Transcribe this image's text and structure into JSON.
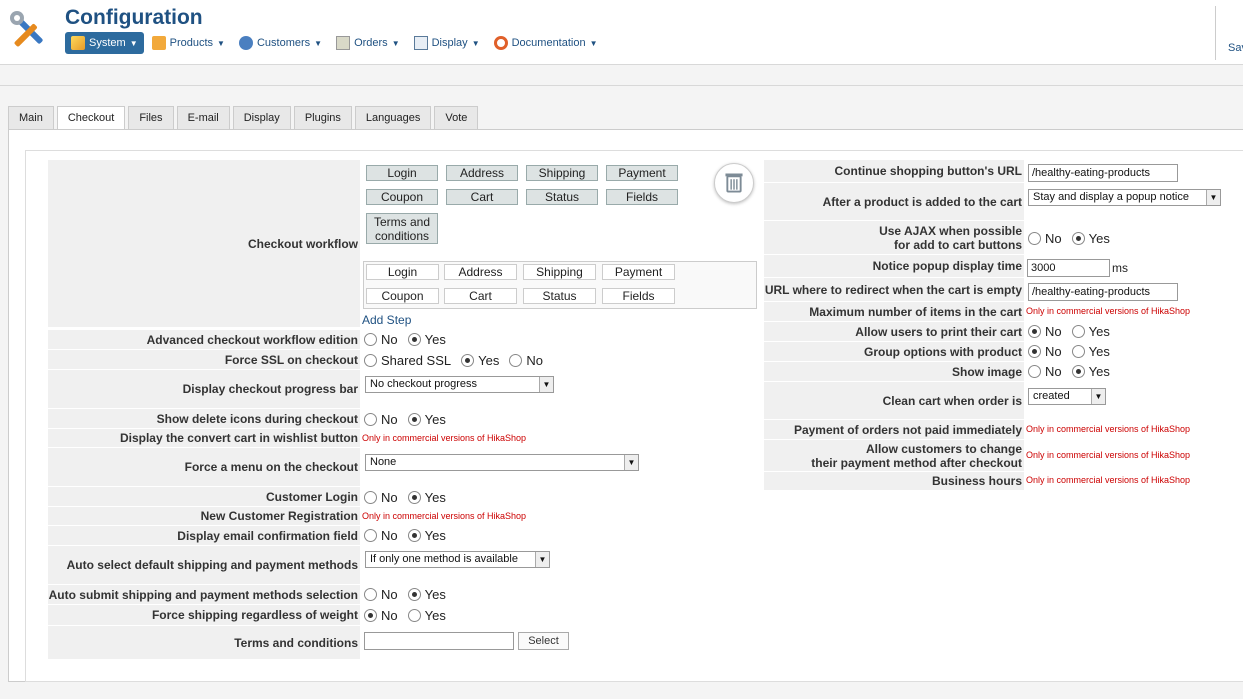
{
  "header": {
    "title": "Configuration",
    "save_label": "Sav",
    "menu": [
      {
        "label": "System"
      },
      {
        "label": "Products"
      },
      {
        "label": "Customers"
      },
      {
        "label": "Orders"
      },
      {
        "label": "Display"
      },
      {
        "label": "Documentation"
      }
    ]
  },
  "tabs": [
    "Main",
    "Checkout",
    "Files",
    "E-mail",
    "Display",
    "Plugins",
    "Languages",
    "Vote"
  ],
  "active_tab": "Checkout",
  "workflow": {
    "label": "Checkout workflow",
    "row1": [
      "Login",
      "Address",
      "Shipping",
      "Payment"
    ],
    "row2": [
      "Coupon",
      "Cart",
      "Status",
      "Fields"
    ],
    "extra": "Terms and conditions",
    "box_row1": [
      "Login",
      "Address",
      "Shipping",
      "Payment"
    ],
    "box_row2": [
      "Coupon",
      "Cart",
      "Status",
      "Fields"
    ],
    "add_step": "Add Step"
  },
  "left": {
    "advanced_workflow": {
      "label": "Advanced checkout workflow edition",
      "no": "No",
      "yes": "Yes"
    },
    "force_ssl": {
      "label": "Force SSL on checkout",
      "shared": "Shared SSL",
      "yes": "Yes",
      "no": "No"
    },
    "progress_bar": {
      "label": "Display checkout progress bar",
      "value": "No checkout progress"
    },
    "delete_icons": {
      "label": "Show delete icons during checkout",
      "no": "No",
      "yes": "Yes"
    },
    "convert_cart": {
      "label": "Display the convert cart in wishlist button",
      "note": "Only in commercial versions of HikaShop"
    },
    "force_menu": {
      "label": "Force a menu on the checkout",
      "value": "None"
    },
    "customer_login": {
      "label": "Customer Login",
      "no": "No",
      "yes": "Yes"
    },
    "new_registration": {
      "label": "New Customer Registration",
      "note": "Only in commercial versions of HikaShop"
    },
    "email_confirm": {
      "label": "Display email confirmation field",
      "no": "No",
      "yes": "Yes"
    },
    "auto_select": {
      "label": "Auto select default shipping and payment methods",
      "value": "If only one method is available"
    },
    "auto_submit": {
      "label": "Auto submit shipping and payment methods selection",
      "no": "No",
      "yes": "Yes"
    },
    "force_shipping": {
      "label": "Force shipping regardless of weight",
      "no": "No",
      "yes": "Yes"
    },
    "terms": {
      "label": "Terms and conditions",
      "value": "",
      "button": "Select"
    }
  },
  "right": {
    "continue_url": {
      "label": "Continue shopping button's URL",
      "value": "/healthy-eating-products"
    },
    "after_add": {
      "label": "After a product is added to the cart",
      "value": "Stay and display a popup notice"
    },
    "ajax": {
      "label1": "Use AJAX when possible",
      "label2": "for add to cart buttons",
      "no": "No",
      "yes": "Yes"
    },
    "notice_time": {
      "label": "Notice popup display time",
      "value": "3000",
      "unit": "ms"
    },
    "redirect_url": {
      "label": "URL where to redirect when the cart is empty",
      "value": "/healthy-eating-products"
    },
    "max_items": {
      "label": "Maximum number of items in the cart",
      "note": "Only in commercial versions of HikaShop"
    },
    "print_cart": {
      "label": "Allow users to print their cart",
      "no": "No",
      "yes": "Yes"
    },
    "group_options": {
      "label": "Group options with product",
      "no": "No",
      "yes": "Yes"
    },
    "show_image": {
      "label": "Show image",
      "no": "No",
      "yes": "Yes"
    },
    "clean_cart": {
      "label": "Clean cart when order is",
      "value": "created"
    },
    "payment_not_paid": {
      "label": "Payment of orders not paid immediately",
      "note": "Only in commercial versions of HikaShop"
    },
    "change_payment": {
      "label1": "Allow customers to change",
      "label2": "their payment method after checkout",
      "note": "Only in commercial versions of HikaShop"
    },
    "business_hours": {
      "label": "Business hours",
      "note": "Only in commercial versions of HikaShop"
    }
  }
}
